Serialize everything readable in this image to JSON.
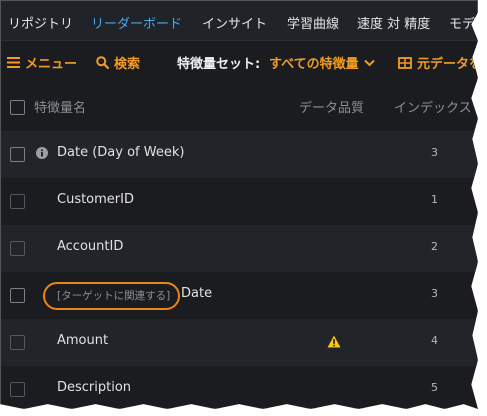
{
  "nav": {
    "items": [
      "リポジトリ",
      "リーダーボード",
      "インサイト",
      "学習曲線",
      "速度 対 精度",
      "モデル"
    ],
    "active": "リーダーボード"
  },
  "toolbar": {
    "menu_label": "メニュー",
    "search_label": "検索",
    "feature_set_label": "特徴量セット:",
    "feature_set_value": "すべての特徴量",
    "original_data_label": "元データを"
  },
  "table": {
    "headers": {
      "feature_name": "特徴量名",
      "data_quality": "データ品質",
      "index": "インデックス"
    },
    "rows": [
      {
        "name": "Date (Day of Week)",
        "index": "3",
        "icon": "info-icon",
        "checkbox_style": "bright"
      },
      {
        "name": "CustomerID",
        "index": "1",
        "checkbox_style": "dim"
      },
      {
        "name": "AccountID",
        "index": "2",
        "checkbox_style": "dim"
      },
      {
        "name": "Date",
        "index": "3",
        "target_leakage_tag": "[ターゲットに関連する]",
        "checkbox_style": "bright"
      },
      {
        "name": "Amount",
        "index": "4",
        "quality_icon": "warning-icon",
        "checkbox_style": "dim"
      },
      {
        "name": "Description",
        "index": "5",
        "checkbox_style": "dim"
      }
    ]
  },
  "colors": {
    "accent_orange": "#f39c23",
    "nav_active_blue": "#4aa8e8",
    "background": "#1a1c1f",
    "row_alt": "#212428",
    "warning_yellow": "#f5c518",
    "highlight_ring": "#e8851e"
  }
}
